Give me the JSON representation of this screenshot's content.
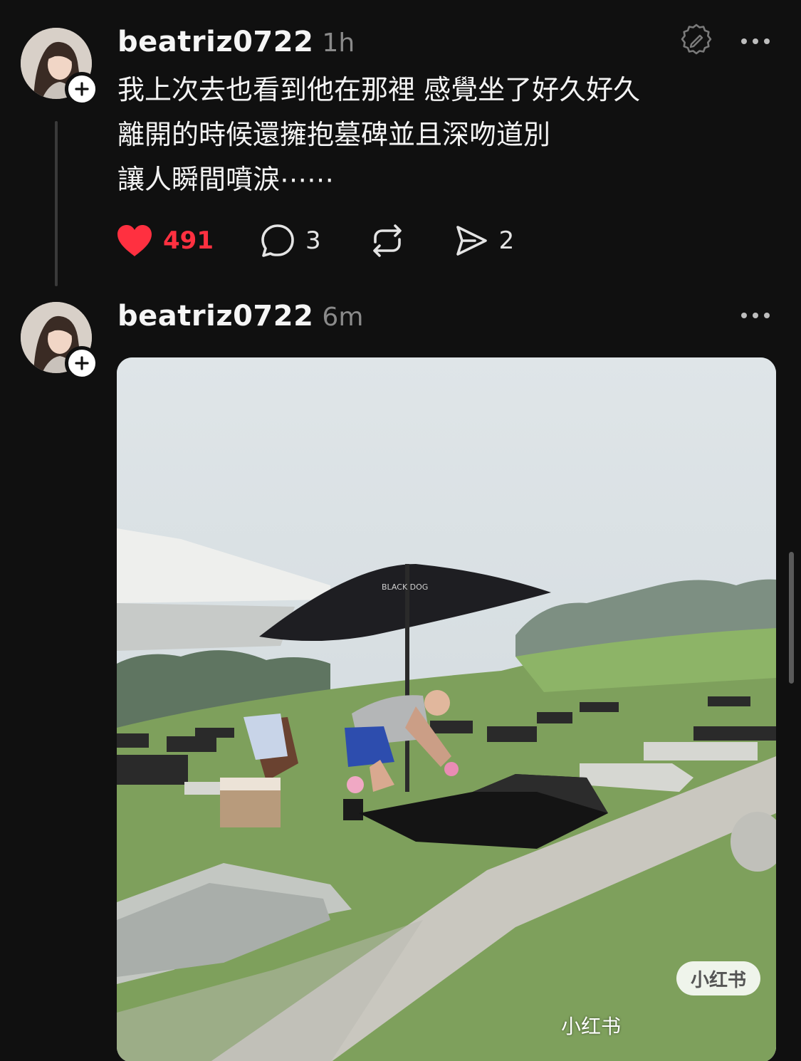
{
  "post1": {
    "username": "beatriz0722",
    "timestamp": "1h",
    "avatar_icon": "profile-photo",
    "lines": [
      "我上次去也看到他在那裡 感覺坐了好久好久",
      "離開的時候還擁抱墓碑並且深吻道別",
      "讓人瞬間噴淚⋯⋯"
    ],
    "likes": "491",
    "comments": "3",
    "shares": "2",
    "liked": true,
    "like_color": "#ff3040"
  },
  "post2": {
    "username": "beatriz0722",
    "timestamp": "6m",
    "image": {
      "umbrella_label": "BLACK DOG",
      "watermark_badge": "小红书",
      "watermark_text": "小红书 "
    }
  },
  "icons": {
    "edit": "edit-badge-icon",
    "more": "more-dots-icon",
    "like": "heart-icon",
    "comment": "comment-bubble-icon",
    "repost": "repost-arrows-icon",
    "share": "send-icon",
    "follow": "plus-icon"
  }
}
